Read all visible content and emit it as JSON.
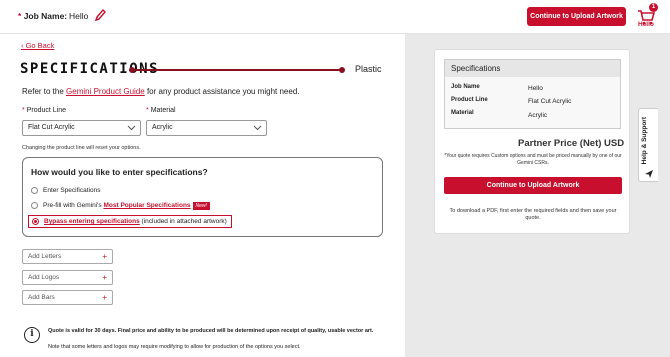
{
  "header": {
    "job_label": "Job Name:",
    "job_required": "*",
    "job_value": "Hello",
    "upload_button": "Continue to Upload Artwork",
    "cart_count": "1",
    "cart_label": "Hello"
  },
  "main": {
    "back_link": "Go Back",
    "title": "SPECIFICATIONS",
    "material_tag": "Plastic",
    "refer_prefix": "Refer to the ",
    "refer_link": "Gemini Product Guide",
    "refer_suffix": " for any product assistance you might need.",
    "product_line_label": "Product Line",
    "material_label": "Material",
    "required_mark": "*",
    "product_line_value": "Flat Cut Acrylic",
    "material_value": "Acrylic",
    "reset_note": "Changing the product line will reset your options.",
    "how_title": "How would you like to enter specifications?",
    "options": {
      "enter": "Enter Specifications",
      "prefill_prefix": "Pre-fill with Gemini's ",
      "prefill_link": "Most Popular Specifications",
      "new_badge": "New!",
      "bypass_link": "Bypass entering specifications",
      "bypass_suffix": " (included in attached artwork)"
    },
    "add_letters": "Add Letters",
    "add_logos": "Add Logos",
    "add_bars": "Add Bars",
    "plus": "+",
    "info_icon": "i",
    "info_line1": "Quote is valid for 30 days. Final price and ability to be produced will be determined upon receipt of quality, usable vector art.",
    "info_line2": "Note that some letters and logos may require modifying to allow for production of the options you select."
  },
  "summary": {
    "heading": "Specifications",
    "rows": [
      {
        "key": "Job Name",
        "value": "Hello"
      },
      {
        "key": "Product Line",
        "value": "Flat Cut Acrylic"
      },
      {
        "key": "Material",
        "value": "Acrylic"
      }
    ],
    "price_label": "Partner Price (Net) USD",
    "price_note": "*Your quote requires Custom options and must be priced manually by one of our Gemini CSRs.",
    "upload_button": "Continue to Upload Artwork",
    "pdf_note": "To download a PDF, first enter the required fields and then save your quote."
  },
  "help_tab": "Help & Support",
  "colors": {
    "accent": "#c8102e",
    "title_rule": "#8a1020"
  }
}
